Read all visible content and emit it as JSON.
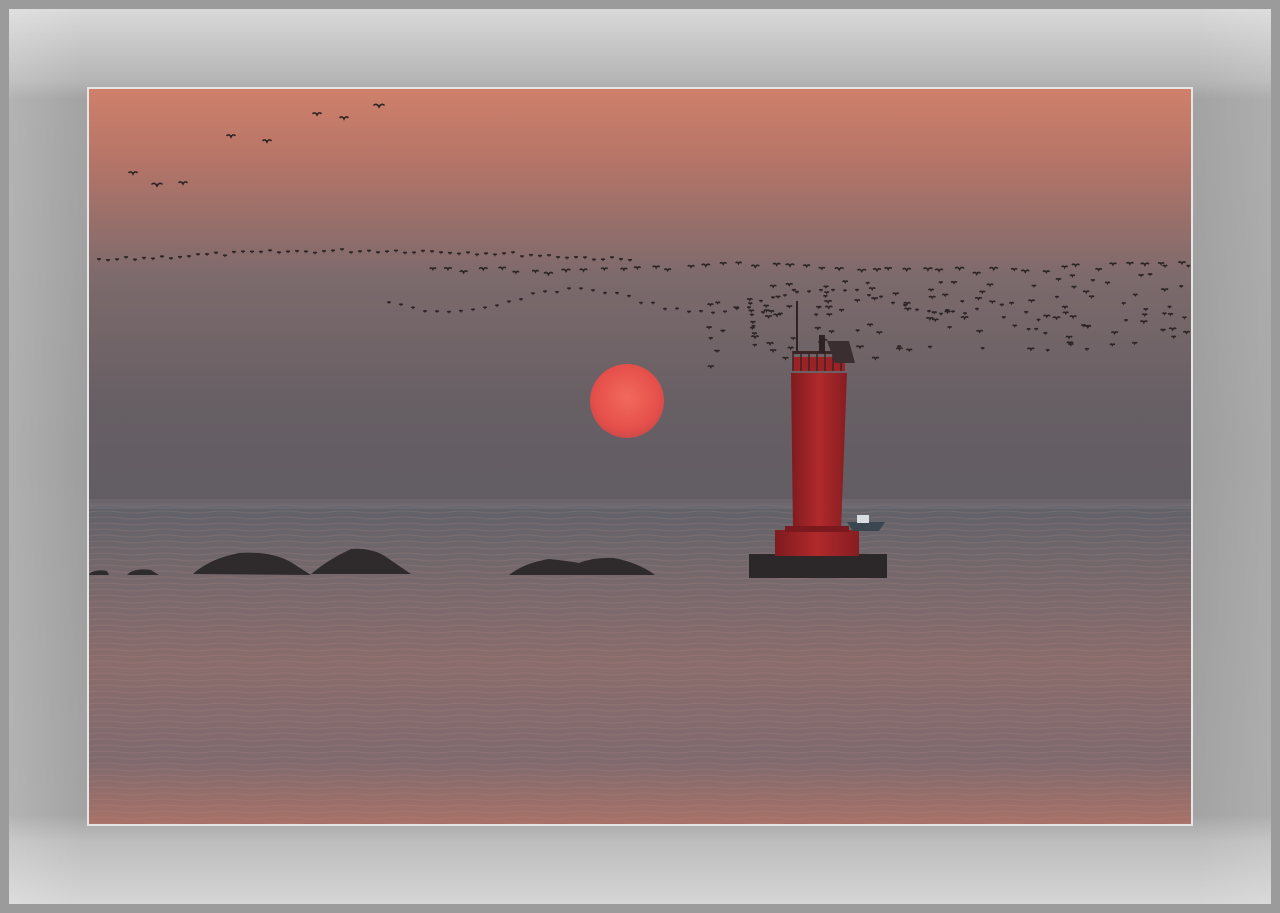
{
  "scene": {
    "subject": "sunset-over-sea-with-lighthouse",
    "elements": [
      "sun",
      "red-lighthouse",
      "rocks",
      "flock-of-birds",
      "small-boat"
    ]
  },
  "colors": {
    "frame": "#9e9e9e",
    "sky_top": "#c97a66",
    "sky_bottom": "#6b6366",
    "sun": "#e8574f",
    "lighthouse": "#b1272a",
    "water": "#7d6d70"
  }
}
